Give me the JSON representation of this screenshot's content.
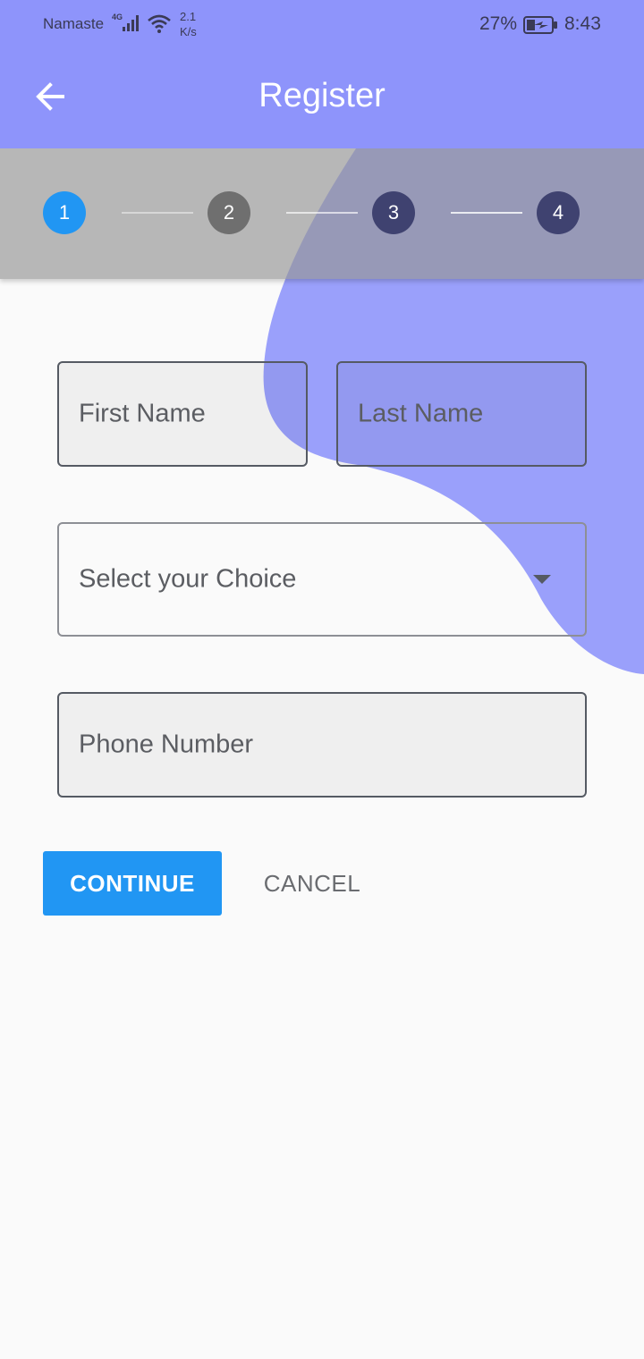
{
  "status_bar": {
    "carrier": "Namaste",
    "network_type": "4G",
    "speed_value": "2.1",
    "speed_unit": "K/s",
    "battery_percent": "27%",
    "time": "8:43"
  },
  "app_bar": {
    "title": "Register",
    "back_icon": "arrow-left-icon"
  },
  "stepper": {
    "steps": [
      {
        "label": "1",
        "state": "active",
        "color": "#2196f3"
      },
      {
        "label": "2",
        "state": "inactive",
        "color": "#6f6f6f"
      },
      {
        "label": "3",
        "state": "inactive",
        "color": "#3f4270"
      },
      {
        "label": "4",
        "state": "inactive",
        "color": "#3f4270"
      }
    ]
  },
  "form": {
    "first_name_placeholder": "First Name",
    "last_name_placeholder": "Last Name",
    "choice_placeholder": "Select your Choice",
    "phone_placeholder": "Phone Number"
  },
  "actions": {
    "continue_label": "CONTINUE",
    "cancel_label": "CANCEL"
  },
  "colors": {
    "header": "#8e94fb",
    "accent": "#2196f3",
    "blob": "#9aa0fb"
  }
}
